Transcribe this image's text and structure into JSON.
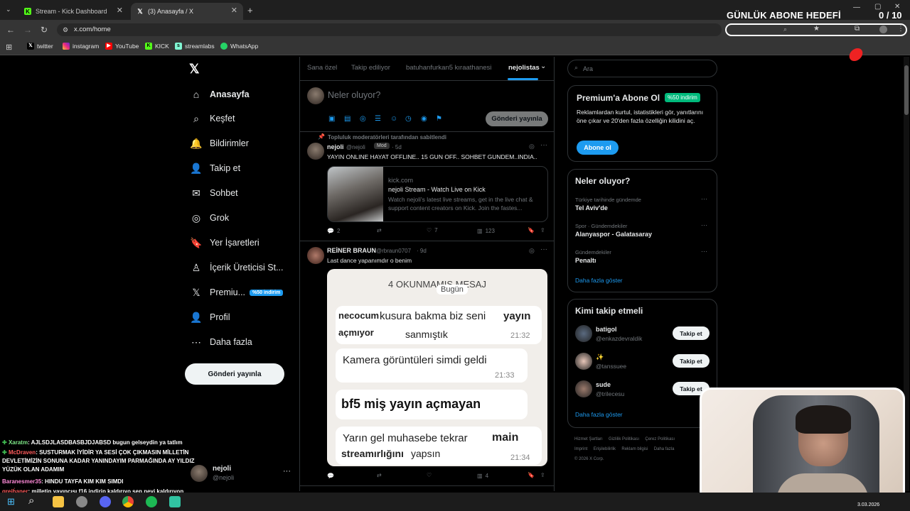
{
  "browser": {
    "tabs": [
      {
        "title": "Stream - Kick Dashboard"
      },
      {
        "title": "(3) Anasayfa / X"
      }
    ],
    "url": "x.com/home",
    "bookmarks": [
      "twitter",
      "instagram",
      "YouTube",
      "KICK",
      "streamlabs",
      "WhatsApp"
    ]
  },
  "overlay": {
    "goal_title": "GÜNLÜK ABONE HEDEFİ",
    "goal_count": "0  / 10",
    "goal_progress": 0
  },
  "nav": {
    "items": [
      {
        "label": "Anasayfa",
        "icon": "home-icon"
      },
      {
        "label": "Keşfet",
        "icon": "search-icon"
      },
      {
        "label": "Bildirimler",
        "icon": "bell-icon"
      },
      {
        "label": "Takip et",
        "icon": "add-user-icon"
      },
      {
        "label": "Sohbet",
        "icon": "mail-icon"
      },
      {
        "label": "Grok",
        "icon": "grok-icon"
      },
      {
        "label": "Yer İşaretleri",
        "icon": "bookmark-icon"
      },
      {
        "label": "İçerik Üreticisi St...",
        "icon": "creator-icon"
      },
      {
        "label": "Premiu...",
        "icon": "x-icon"
      },
      {
        "label": "Profil",
        "icon": "user-icon"
      },
      {
        "label": "Daha fazla",
        "icon": "more-circle-icon"
      }
    ],
    "premium_badge": "%50 indirim",
    "post_button": "Gönderi yayınla",
    "account_name": "nejoli",
    "account_handle": "@nejoli"
  },
  "feed": {
    "tabs": [
      "Sana özel",
      "Takip ediliyor",
      "batuhanfurkan5 kıraathanesi",
      "nejolistas"
    ],
    "composer_placeholder": "Neler oluyor?",
    "composer_button": "Gönderi yayınla",
    "pinned_label": "Topluluk moderatörleri tarafından sabitlendi",
    "post1": {
      "name": "nejoli",
      "handle": "@nejoli",
      "badge": "Mod",
      "time": "· 5d",
      "text": "YAYIN ONLINE HAYAT OFFLINE.. 15 GUN OFF.. SOHBET GUNDEM..INDIA..",
      "card_domain": "kick.com",
      "card_title": "nejoli Stream - Watch Live on Kick",
      "card_desc": "Watch nejoli's latest live streams, get in the live chat & support content creators on Kick. Join the fastes...",
      "replies": "2",
      "likes": "7",
      "views": "123"
    },
    "post2": {
      "name": "REİNER BRAUN",
      "handle": "@rbraun0707",
      "time": "· 9d",
      "text": "Last dance yapanımdır o benim",
      "views": "4",
      "image_lines": [
        "4 OKUNMAMIŞ MESAJ",
        "Bugün",
        "necocum",
        "kusura bakma biz seni",
        "yayın",
        "açmıyor",
        "sanmıştık",
        "21:32",
        "Kamera görüntüleri simdi geldi",
        "21:33",
        "bf5 miş yayın açmayan",
        "Yarın gel muhasebe tekrar",
        "main",
        "streamırlığını",
        "yapsın",
        "21:34"
      ]
    }
  },
  "right": {
    "search_placeholder": "Ara",
    "premium": {
      "title": "Premium'a Abone Ol",
      "badge": "%50 indirim",
      "desc": "Reklamlardan kurtul, istatistikleri gör, yanıtlarını öne çıkar ve 20'den fazla özelliğin kilidini aç.",
      "button": "Abone ol"
    },
    "trends": {
      "title": "Neler oluyor?",
      "items": [
        {
          "context": "Türkiye tarihinde gündemde",
          "name": "Tel Aviv'de"
        },
        {
          "context": "Spor · Gündemdekiler",
          "name": "Alanyaspor - Galatasaray"
        },
        {
          "context": "Gündemdekiler",
          "name": "Penaltı"
        }
      ],
      "more": "Daha fazla göster"
    },
    "who_to_follow": {
      "title": "Kimi takip etmeli",
      "users": [
        {
          "name": "batigol",
          "handle": "@enkazdevraldik"
        },
        {
          "name": "✨",
          "handle": "@tanssuee"
        },
        {
          "name": "sude",
          "handle": "@trilecesu"
        }
      ],
      "follow_label": "Takip et",
      "more": "Daha fazla göster"
    },
    "footer": [
      "Hizmet Şartları",
      "Gizlilik Politikası",
      "Çerez Politikası",
      "Imprint",
      "Erişilebilirlik",
      "Reklam bilgisi",
      "Daha fazla",
      "© 2026 X Corp."
    ]
  },
  "chat": [
    {
      "user": "Xaratm",
      "msg": ": AJLSDJLASDBASBJDJABSD bugun gelseydin ya tatlım",
      "color": "#7ee787"
    },
    {
      "user": "McDraven",
      "msg": ": SUSTURMAK İYİDİR YA SESİ ÇOK ÇIKMASIN MİLLETİN DEVLETİMİZİN SONUNA KADAR YANINDAYIM PARMAĞINDA AY YILDIZ YÜZÜK OLAN ADAMIM",
      "color": "#ff5c5c"
    },
    {
      "user": "Baranesmer35",
      "msg": ": HINDU TAYFA KIM KIM SIMDI",
      "color": "#ff8ad8"
    },
    {
      "user": "greiḣaner",
      "msg": ": milletin yayıncısı f16 indirip kaldırıyo sen neyi kaldırıyon",
      "color": "#ff5c5c"
    }
  ],
  "taskbar": {
    "date": "3.03.2026"
  }
}
